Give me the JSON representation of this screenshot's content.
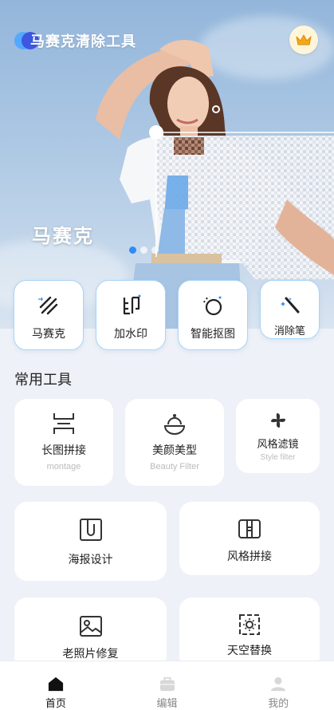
{
  "header": {
    "app_title": "马赛克清除工具"
  },
  "banner": {
    "label": "马赛克",
    "slide_count": 3,
    "active_slide": 1
  },
  "quick_tools": [
    {
      "label": "马赛克",
      "icon": "mosaic-stripes-icon"
    },
    {
      "label": "加水印",
      "icon": "watermark-print-icon"
    },
    {
      "label": "智能抠图",
      "icon": "smart-cutout-icon"
    },
    {
      "label": "消除笔",
      "icon": "magic-eraser-pen-icon"
    }
  ],
  "common_tools": {
    "title": "常用工具",
    "items": [
      {
        "label": "长图拼接",
        "sub": "montage",
        "icon": "montage-icon"
      },
      {
        "label": "美颜美型",
        "sub": "Beauty Filter",
        "icon": "beauty-bowl-icon"
      },
      {
        "label": "风格滤镜",
        "sub": "Style filter",
        "icon": "style-filter-flower-icon"
      },
      {
        "label": "海报设计",
        "sub": "",
        "icon": "poster-design-icon"
      },
      {
        "label": "风格拼接",
        "sub": "",
        "icon": "style-collage-icon"
      },
      {
        "label": "老照片修复",
        "sub": "",
        "icon": "photo-restore-icon"
      },
      {
        "label": "天空替换",
        "sub": "",
        "icon": "sky-replace-icon"
      }
    ]
  },
  "tabbar": [
    {
      "label": "首页",
      "icon": "home-icon",
      "active": true
    },
    {
      "label": "编辑",
      "icon": "briefcase-icon",
      "active": false
    },
    {
      "label": "我的",
      "icon": "person-icon",
      "active": false
    }
  ],
  "colors": {
    "accent": "#2f8cf5",
    "quick_border": "#a9d4f7",
    "background": "#eef1f7"
  }
}
